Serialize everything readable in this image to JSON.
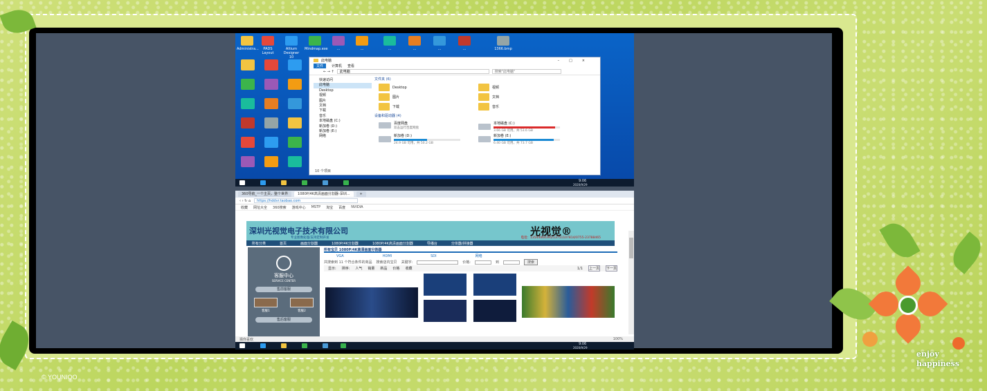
{
  "desktop": {
    "top_icons": [
      "Administra...",
      "PADS Layout",
      "Altium Designer 10",
      "Mindmap.exe",
      "...",
      "...",
      "...",
      "...",
      "...",
      "...",
      "1366.bmp"
    ],
    "taskbar_time": "9:06",
    "taskbar_date": "2020/9/29"
  },
  "explorer": {
    "title": "此电脑",
    "ribbon": [
      "文件",
      "计算机",
      "查看"
    ],
    "address": "此电脑",
    "search_placeholder": "搜索\"此电脑\"",
    "sidebar": [
      "快速访问",
      "此电脑",
      "Desktop",
      "视频",
      "图片",
      "文档",
      "下载",
      "音乐",
      "本地磁盘 (C:)",
      "新加卷 (D:)",
      "新加卷 (E:)",
      "网络"
    ],
    "folders_header": "文件夹 (6)",
    "folders": [
      "Desktop",
      "视频",
      "图片",
      "文档",
      "下载",
      "音乐"
    ],
    "drives_header": "设备和驱动器 (4)",
    "drives": [
      {
        "name": "百度网盘",
        "detail": "双击运行百度网盘",
        "fill": 0,
        "color": "#1a73c7"
      },
      {
        "name": "本地磁盘 (C:)",
        "detail": "3.66 GB 可用，共 53.6 GB",
        "fill": 0.93,
        "color": "#da2a2a"
      },
      {
        "name": "新加卷 (D:)",
        "detail": "24.9 GB 可用，共 50.2 GB",
        "fill": 0.5,
        "color": "#1a8ad4"
      },
      {
        "name": "新加卷 (E:)",
        "detail": "6.40 GB 可用，共 73.7 GB",
        "fill": 0.91,
        "color": "#1a8ad4"
      }
    ],
    "status": "10 个项目"
  },
  "browser": {
    "tabs": [
      "360导航_一个主页，整个世界",
      "1080P/4K高清画面分割器-深圳...",
      "+"
    ],
    "url": "https://hddvr.taobao.com",
    "bookmarks": [
      "收藏",
      "网址大全",
      "360搜索",
      "游戏中心",
      "MSTP",
      "淘宝",
      "百度",
      "NVIDIA"
    ],
    "company_name": "深圳光视觉电子技术有限公司",
    "brand": "光视觉®",
    "company_sub": "专业图像处理/支持定制开发",
    "phone": "电话：13544064395/13751107814/0755-23788465",
    "nav": [
      "所有分类",
      "首页",
      "画面分割器",
      "1080P/4K分割器",
      "1080P/4K高清画面分割器",
      "导播台",
      "分体器/拼接器"
    ],
    "service_title": "客服中心",
    "service_sub": "SERVICE CENTER",
    "service_buttons": [
      "售前客服",
      "售后客服"
    ],
    "service_names": [
      "客服1",
      "客服2"
    ],
    "product_title": "所有宝贝   1080P/4K高清画面分割器",
    "product_tabs": [
      "VGA",
      "HDMI",
      "SDI",
      "网络"
    ],
    "filter_label": "共搜索到 11 个符合条件的商品",
    "filter_fields": [
      "搜索店内宝贝",
      "关键字:",
      "价格:",
      "到"
    ],
    "search_button": "搜索",
    "sort_items": [
      "显示:",
      "排序:",
      "人气",
      "销量",
      "新品",
      "价格",
      "收藏"
    ],
    "page_info": "1/1",
    "page_buttons": [
      "上一页",
      "下一页"
    ],
    "status_left": "猜你喜欢",
    "status_right": [
      "100%"
    ]
  },
  "decor": {
    "enjoy_line1": "enjoy",
    "enjoy_line2": "happiness",
    "watermark": "© YOUNIOO"
  }
}
